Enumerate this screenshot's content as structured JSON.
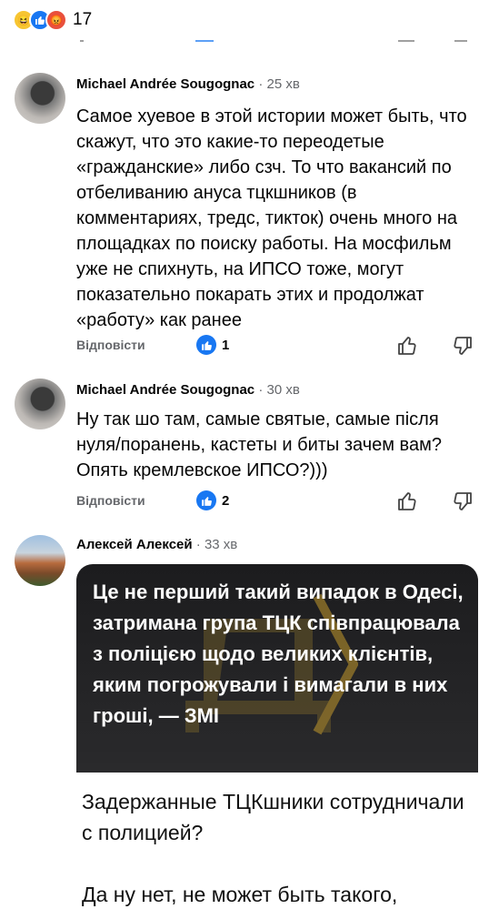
{
  "top": {
    "reaction_icons": [
      "haha-icon",
      "like-icon",
      "angry-icon"
    ],
    "reaction_count": "17"
  },
  "comments": [
    {
      "author": "Michael Andrée Sougognac",
      "time": " · 25 хв",
      "text": "Самое хуевое в этой истории может быть, что скажут, что это какие-то переодетые «гражданские» либо сзч. То что вакансий по отбеливанию ануса тцкшников (в комментариях, тредс, тикток) очень много на площадках по поиску работы. На мосфильм уже не спихнуть, на ИПСО тоже, могут показательно покарать этих и продолжат «работу» как ранее",
      "reply_label": "Відповісти",
      "likes": "1"
    },
    {
      "author": "Michael Andrée Sougognac",
      "time": " · 30 хв",
      "text": "Ну так шо там, самые святые, самые після нуля/поранень, кастеты и биты зачем вам? Опять кремлевское ИПСО?)))",
      "reply_label": "Відповісти",
      "likes": "2"
    },
    {
      "author": "Алексей Алексей",
      "time": " · 33 хв",
      "media_headline": "Це не перший такий випадок в Одесі, затримана група ТЦК співпрацювала з поліцією щодо великих клієнтів, яким погрожували і вимагали в них гроші, — ЗМІ",
      "media_text_1": "Задержанные ТЦКшники сотрудничали с полицией?",
      "media_text_2": "Да ну нет, не может быть такого,"
    }
  ],
  "colors": {
    "accent": "#1877f2",
    "secondary_text": "#65676b",
    "media_dark": "#1c1c1e"
  }
}
